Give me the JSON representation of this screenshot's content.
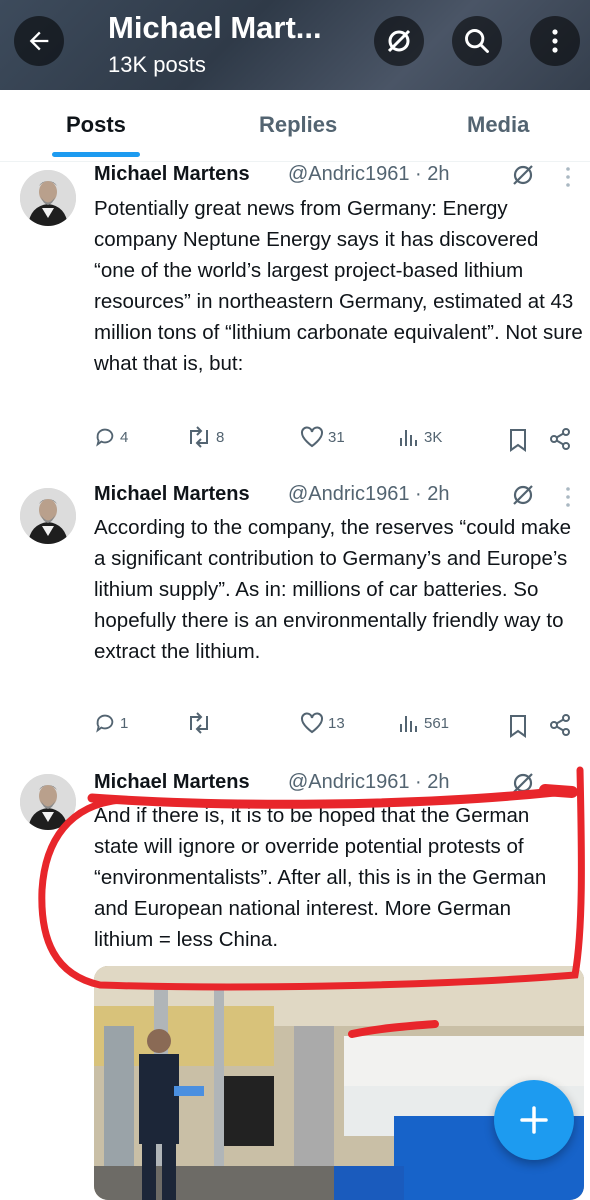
{
  "header": {
    "title": "Michael Mart...",
    "posts_count": "13K posts"
  },
  "tabs": [
    {
      "label": "Posts",
      "active": true
    },
    {
      "label": "Replies",
      "active": false
    },
    {
      "label": "Media",
      "active": false
    }
  ],
  "posts": [
    {
      "name": "Michael Martens",
      "handle_time": "@Andric1961 · 2h",
      "text": "Potentially great news from Germany: Energy company Neptune Energy says it has discovered “one of the world’s largest project-based lithium resources” in northeastern Germany, estimated at 43 million tons of “lithium carbonate equivalent”. Not sure what that is, but:",
      "replies": "4",
      "reposts": "8",
      "likes": "31",
      "views": "3K"
    },
    {
      "name": "Michael Martens",
      "handle_time": "@Andric1961 · 2h",
      "text": "According to the company, the reserves “could make a significant contribution to Germany’s and Europe’s lithium supply”. As in: millions of car batteries. So hopefully there is an environmentally friendly way to extract the lithium.",
      "replies": "1",
      "reposts": "",
      "likes": "13",
      "views": "561"
    },
    {
      "name": "Michael Martens",
      "handle_time": "@Andric1961 · 2h",
      "text": "And if there is, it is to be hoped that the German state will ignore or override potential protests of “environmentalists”. After all, this is in the German and European national interest. More German lithium = less China."
    }
  ],
  "colors": {
    "accent": "#1d9bf0",
    "annotation": "#e8262b",
    "secondary_text": "#536471"
  },
  "icons": [
    "back-arrow-icon",
    "grok-icon",
    "search-icon",
    "more-vertical-icon",
    "reply-icon",
    "repost-icon",
    "like-icon",
    "views-icon",
    "bookmark-icon",
    "share-icon",
    "compose-plus-icon"
  ]
}
